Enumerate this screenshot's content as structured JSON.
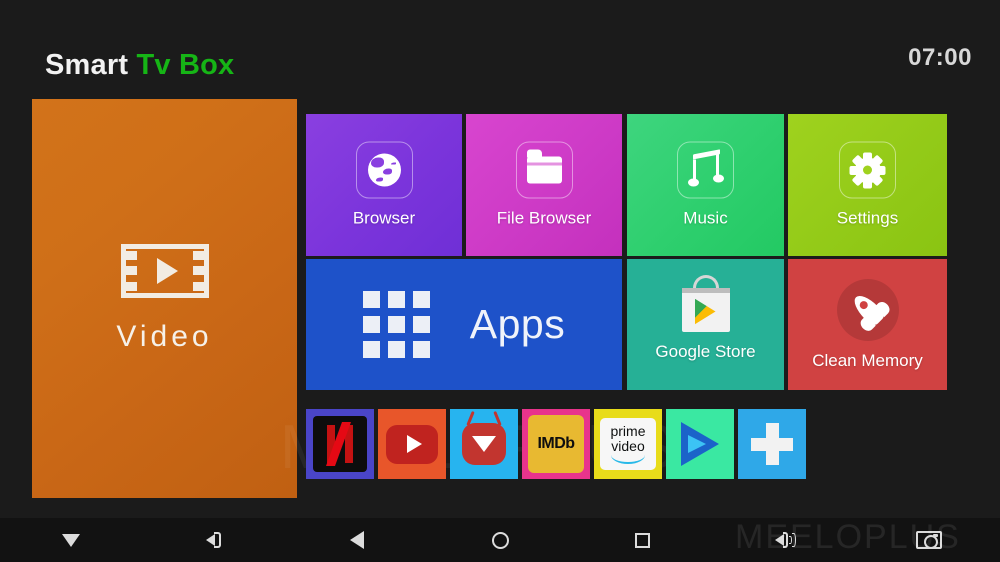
{
  "header": {
    "brand_part1": "Smart ",
    "brand_part2": "Tv Box",
    "clock": "07:00",
    "brand_color_1": "#f2f2f2",
    "brand_color_2": "#16b516"
  },
  "hero": {
    "label": "Video",
    "icon": "film-play-icon",
    "color": "#cf6f18"
  },
  "tiles": [
    {
      "id": "browser",
      "label": "Browser",
      "icon": "globe-icon",
      "color": "#7b34db"
    },
    {
      "id": "file",
      "label": "File Browser",
      "icon": "folder-icon",
      "color": "#cd3ac6"
    },
    {
      "id": "music",
      "label": "Music",
      "icon": "music-note-icon",
      "color": "#2ecf6e"
    },
    {
      "id": "settings",
      "label": "Settings",
      "icon": "gear-icon",
      "color": "#93ca18"
    },
    {
      "id": "apps",
      "label": "Apps",
      "icon": "grid-apps-icon",
      "color": "#1e52c9"
    },
    {
      "id": "store",
      "label": "Google Store",
      "icon": "play-store-icon",
      "color": "#26b096"
    },
    {
      "id": "clean",
      "label": "Clean Memory",
      "icon": "rocket-icon",
      "color": "#d04242"
    }
  ],
  "shortcuts": [
    {
      "id": "netflix",
      "name": "Netflix",
      "icon": "netflix-icon",
      "color": "#4a45c8"
    },
    {
      "id": "youtube",
      "name": "YouTube",
      "icon": "youtube-icon",
      "color": "#e8562a"
    },
    {
      "id": "tv",
      "name": "TV App",
      "icon": "tv-app-icon",
      "color": "#27b4ef"
    },
    {
      "id": "imdb",
      "name": "IMDb",
      "icon": "imdb-icon",
      "color": "#e8348c",
      "text": "IMDb"
    },
    {
      "id": "prime",
      "name": "prime video",
      "icon": "prime-video-icon",
      "color": "#e8dc1a",
      "line1": "prime",
      "line2": "video"
    },
    {
      "id": "mx",
      "name": "MX Player",
      "icon": "mx-player-icon",
      "color": "#3ae8a2"
    },
    {
      "id": "plus",
      "name": "Add App",
      "icon": "plus-icon",
      "color": "#2fa8e8"
    }
  ],
  "watermark": {
    "text_main": "MEELOPLUS",
    "text_small": "MEELOPLUS"
  },
  "navbar": [
    {
      "id": "volume-down",
      "icon": "volume-down-icon"
    },
    {
      "id": "mute",
      "icon": "speaker-icon"
    },
    {
      "id": "back",
      "icon": "back-triangle-icon"
    },
    {
      "id": "home",
      "icon": "home-circle-icon"
    },
    {
      "id": "recents",
      "icon": "recents-square-icon"
    },
    {
      "id": "volume-up",
      "icon": "volume-up-icon"
    },
    {
      "id": "screenshot",
      "icon": "camera-icon"
    }
  ]
}
